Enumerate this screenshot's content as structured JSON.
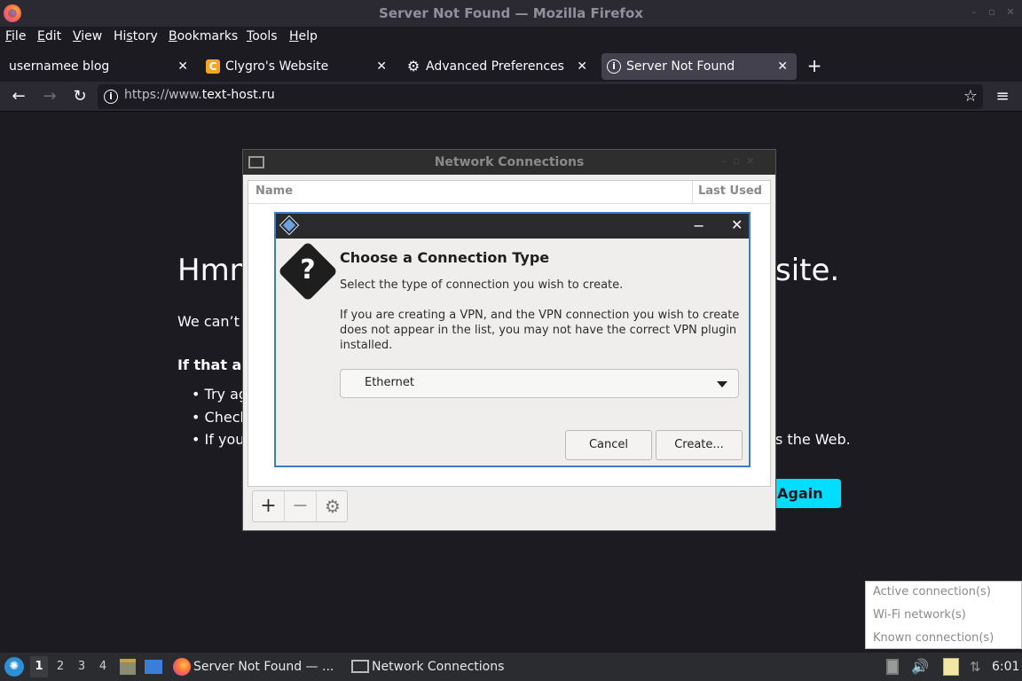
{
  "window": {
    "title": "Server Not Found — Mozilla Firefox"
  },
  "menubar": [
    {
      "label": "File",
      "ul": "F",
      "rest": "ile"
    },
    {
      "label": "Edit",
      "ul": "E",
      "rest": "dit"
    },
    {
      "label": "View",
      "ul": "V",
      "rest": "iew"
    },
    {
      "label": "History",
      "ul": "",
      "pre": "Hi",
      "ul2": "s",
      "rest": "tory"
    },
    {
      "label": "Bookmarks",
      "ul": "B",
      "rest": "ookmarks"
    },
    {
      "label": "Tools",
      "ul": "T",
      "rest": "ools"
    },
    {
      "label": "Help",
      "ul": "H",
      "rest": "elp"
    }
  ],
  "tabs": [
    {
      "label": "usernamee blog",
      "icon": "none"
    },
    {
      "label": "Clygro's Website",
      "icon": "site-icon"
    },
    {
      "label": "Advanced Preferences",
      "icon": "gear-icon"
    },
    {
      "label": "Server Not Found",
      "icon": "info-icon",
      "active": true
    }
  ],
  "navbar": {
    "url_host": "https://www.",
    "url_domain": "text-host.ru"
  },
  "page": {
    "heading_left": "Hmm",
    "heading_right": "site.",
    "line1": "We can’t c",
    "bold": "If that ad",
    "bullet1": "Try ag",
    "bullet2": "Check",
    "bullet3": "If you",
    "bullet3_right": "s the Web.",
    "try_again": "Again"
  },
  "network_window": {
    "title": "Network Connections",
    "col_name": "Name",
    "col_last_used": "Last Used"
  },
  "dialog": {
    "heading": "Choose a Connection Type",
    "subtitle": "Select the type of connection you wish to create.",
    "vpn_note": "If you are creating a VPN, and the VPN connection you wish to create does not appear in the list, you may not have the correct VPN plugin installed.",
    "selected_type": "Ethernet",
    "cancel": "Cancel",
    "create": "Create..."
  },
  "net_menu": [
    "Active connection(s)",
    "Wi-Fi network(s)",
    "Known connection(s)"
  ],
  "taskbar": {
    "workspaces": [
      "1",
      "2",
      "3",
      "4"
    ],
    "tasks": [
      "Server Not Found — ...",
      "Network Connections"
    ],
    "clock": "6:01"
  },
  "colors": {
    "accent": "#3d7cc9",
    "try_again": "#00ddff"
  }
}
